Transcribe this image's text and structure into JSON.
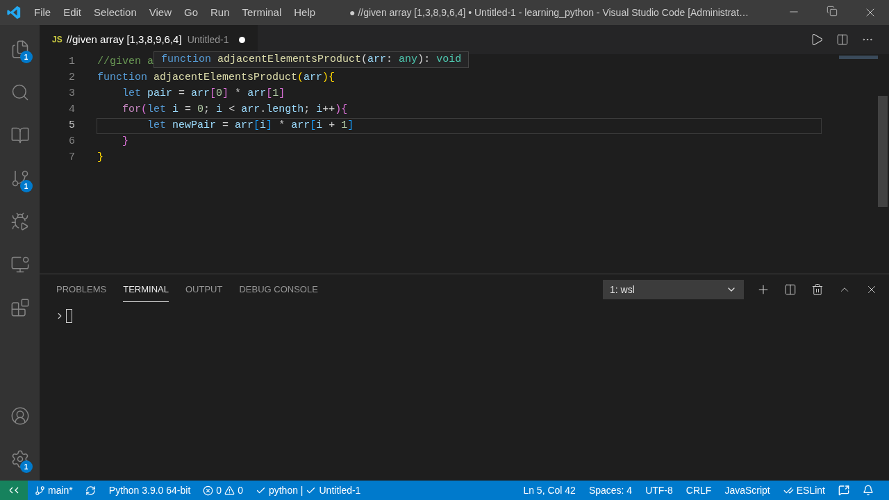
{
  "title_bar": {
    "menu": [
      "File",
      "Edit",
      "Selection",
      "View",
      "Go",
      "Run",
      "Terminal",
      "Help"
    ],
    "title": "● //given array [1,3,8,9,6,4] • Untitled-1 - learning_python - Visual Studio Code [Administrat…"
  },
  "activity_bar": {
    "explorer_badge": "1",
    "source_control_badge": "1",
    "settings_badge": "1"
  },
  "tabs": [
    {
      "language": "JS",
      "title": "//given array [1,3,8,9,6,4]",
      "description": "Untitled-1",
      "dirty": true,
      "selected": true
    }
  ],
  "editor": {
    "lines": [
      {
        "number": "1",
        "current": false,
        "tokens": [
          {
            "text": "//given a",
            "kind": "comment"
          }
        ]
      },
      {
        "number": "2",
        "current": false,
        "tokens": [
          {
            "text": "function ",
            "kind": "keyword"
          },
          {
            "text": "adjacentElementsProduct",
            "kind": "func"
          },
          {
            "text": "(",
            "kind": "b1"
          },
          {
            "text": "arr",
            "kind": "var"
          },
          {
            "text": "){",
            "kind": "b1"
          }
        ]
      },
      {
        "number": "3",
        "current": false,
        "tokens": [
          {
            "text": "    let ",
            "kind": "keyword"
          },
          {
            "text": "pair",
            "kind": "var"
          },
          {
            "text": " = ",
            "kind": "plain"
          },
          {
            "text": "arr",
            "kind": "var"
          },
          {
            "text": "[",
            "kind": "b2"
          },
          {
            "text": "0",
            "kind": "num"
          },
          {
            "text": "]",
            "kind": "b2"
          },
          {
            "text": " * ",
            "kind": "plain"
          },
          {
            "text": "arr",
            "kind": "var"
          },
          {
            "text": "[",
            "kind": "b2"
          },
          {
            "text": "1",
            "kind": "num"
          },
          {
            "text": "]",
            "kind": "b2"
          }
        ]
      },
      {
        "number": "4",
        "current": false,
        "tokens": [
          {
            "text": "    for",
            "kind": "control"
          },
          {
            "text": "(",
            "kind": "b2"
          },
          {
            "text": "let ",
            "kind": "keyword"
          },
          {
            "text": "i",
            "kind": "var"
          },
          {
            "text": " = ",
            "kind": "plain"
          },
          {
            "text": "0",
            "kind": "num"
          },
          {
            "text": "; ",
            "kind": "plain"
          },
          {
            "text": "i",
            "kind": "var"
          },
          {
            "text": " < ",
            "kind": "plain"
          },
          {
            "text": "arr",
            "kind": "var"
          },
          {
            "text": ".",
            "kind": "plain"
          },
          {
            "text": "length",
            "kind": "var"
          },
          {
            "text": "; ",
            "kind": "plain"
          },
          {
            "text": "i",
            "kind": "var"
          },
          {
            "text": "++",
            "kind": "plain"
          },
          {
            "text": "){",
            "kind": "b2"
          }
        ]
      },
      {
        "number": "5",
        "current": true,
        "tokens": [
          {
            "text": "        let ",
            "kind": "keyword"
          },
          {
            "text": "newPair",
            "kind": "var"
          },
          {
            "text": " = ",
            "kind": "plain"
          },
          {
            "text": "arr",
            "kind": "var"
          },
          {
            "text": "[",
            "kind": "b3"
          },
          {
            "text": "i",
            "kind": "var"
          },
          {
            "text": "]",
            "kind": "b3"
          },
          {
            "text": " * ",
            "kind": "plain"
          },
          {
            "text": "arr",
            "kind": "var"
          },
          {
            "text": "[",
            "kind": "b3"
          },
          {
            "text": "i",
            "kind": "var"
          },
          {
            "text": " + ",
            "kind": "plain"
          },
          {
            "text": "1",
            "kind": "num"
          },
          {
            "text": "]",
            "kind": "b3"
          }
        ]
      },
      {
        "number": "6",
        "current": false,
        "tokens": [
          {
            "text": "    }",
            "kind": "b2"
          }
        ]
      },
      {
        "number": "7",
        "current": false,
        "tokens": [
          {
            "text": "}",
            "kind": "b1"
          }
        ]
      }
    ],
    "hover": [
      {
        "text": "function ",
        "kind": "keyword"
      },
      {
        "text": "adjacentElementsProduct",
        "kind": "func"
      },
      {
        "text": "(",
        "kind": "plain"
      },
      {
        "text": "arr",
        "kind": "var"
      },
      {
        "text": ": ",
        "kind": "plain"
      },
      {
        "text": "any",
        "kind": "type"
      },
      {
        "text": "): ",
        "kind": "plain"
      },
      {
        "text": "void",
        "kind": "type"
      }
    ]
  },
  "panel": {
    "tabs": [
      {
        "label": "PROBLEMS",
        "selected": false
      },
      {
        "label": "TERMINAL",
        "selected": true
      },
      {
        "label": "OUTPUT",
        "selected": false
      },
      {
        "label": "DEBUG CONSOLE",
        "selected": false
      }
    ],
    "terminal_select": "1: wsl"
  },
  "status_bar": {
    "branch": "main*",
    "interpreter": "Python 3.9.0 64-bit",
    "errors": "0",
    "warnings": "0",
    "lint": "python |",
    "file": "Untitled-1",
    "position": "Ln 5, Col 42",
    "indent": "Spaces: 4",
    "encoding": "UTF-8",
    "eol": "CRLF",
    "language": "JavaScript",
    "linter": "ESLint"
  }
}
